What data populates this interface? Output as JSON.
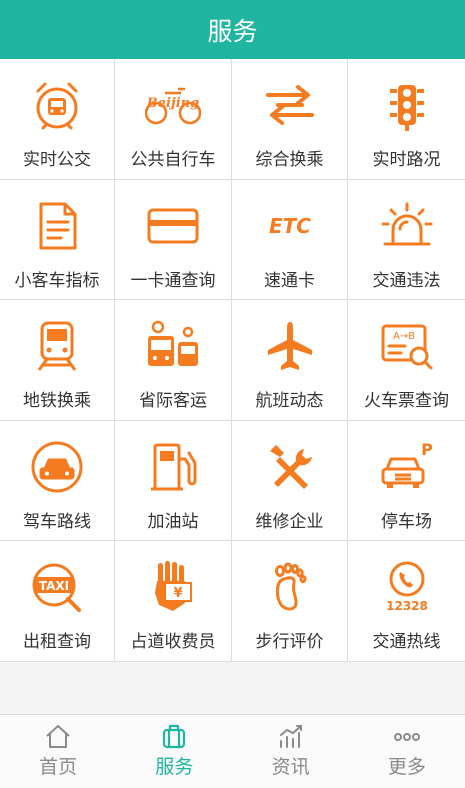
{
  "header": {
    "title": "服务"
  },
  "colors": {
    "accent": "#1fb5a0",
    "icon": "#f47b20",
    "tab_inactive": "#8a8a8a"
  },
  "grid": {
    "items": [
      {
        "label": "实时公交",
        "icon": "bus-clock-icon"
      },
      {
        "label": "公共自行车",
        "icon": "beijing-bike-icon"
      },
      {
        "label": "综合换乘",
        "icon": "transfer-arrows-icon"
      },
      {
        "label": "实时路况",
        "icon": "traffic-light-icon"
      },
      {
        "label": "小客车指标",
        "icon": "document-icon"
      },
      {
        "label": "一卡通查询",
        "icon": "card-icon"
      },
      {
        "label": "速通卡",
        "icon": "etc-icon"
      },
      {
        "label": "交通违法",
        "icon": "siren-light-icon"
      },
      {
        "label": "地铁换乘",
        "icon": "subway-train-icon"
      },
      {
        "label": "省际客运",
        "icon": "coach-bus-icon"
      },
      {
        "label": "航班动态",
        "icon": "airplane-icon"
      },
      {
        "label": "火车票查询",
        "icon": "ticket-search-icon"
      },
      {
        "label": "驾车路线",
        "icon": "car-circle-icon"
      },
      {
        "label": "加油站",
        "icon": "fuel-pump-icon"
      },
      {
        "label": "维修企业",
        "icon": "wrench-screwdriver-icon"
      },
      {
        "label": "停车场",
        "icon": "parking-car-icon"
      },
      {
        "label": "出租查询",
        "icon": "taxi-search-icon"
      },
      {
        "label": "占道收费员",
        "icon": "hand-money-icon"
      },
      {
        "label": "步行评价",
        "icon": "footprint-icon"
      },
      {
        "label": "交通热线",
        "icon": "hotline-phone-icon"
      }
    ],
    "ticket_route_text": "A→B",
    "taxi_sign_text": "TAXI",
    "bike_logo_text": "Beijing",
    "etc_text": "ETC",
    "hotline_number": "12328",
    "currency_symbol": "¥",
    "parking_letter": "P"
  },
  "tabbar": {
    "tabs": [
      {
        "label": "首页",
        "icon": "home-icon",
        "active": false
      },
      {
        "label": "服务",
        "icon": "briefcase-icon",
        "active": true
      },
      {
        "label": "资讯",
        "icon": "chart-trend-icon",
        "active": false
      },
      {
        "label": "更多",
        "icon": "more-dots-icon",
        "active": false
      }
    ]
  }
}
